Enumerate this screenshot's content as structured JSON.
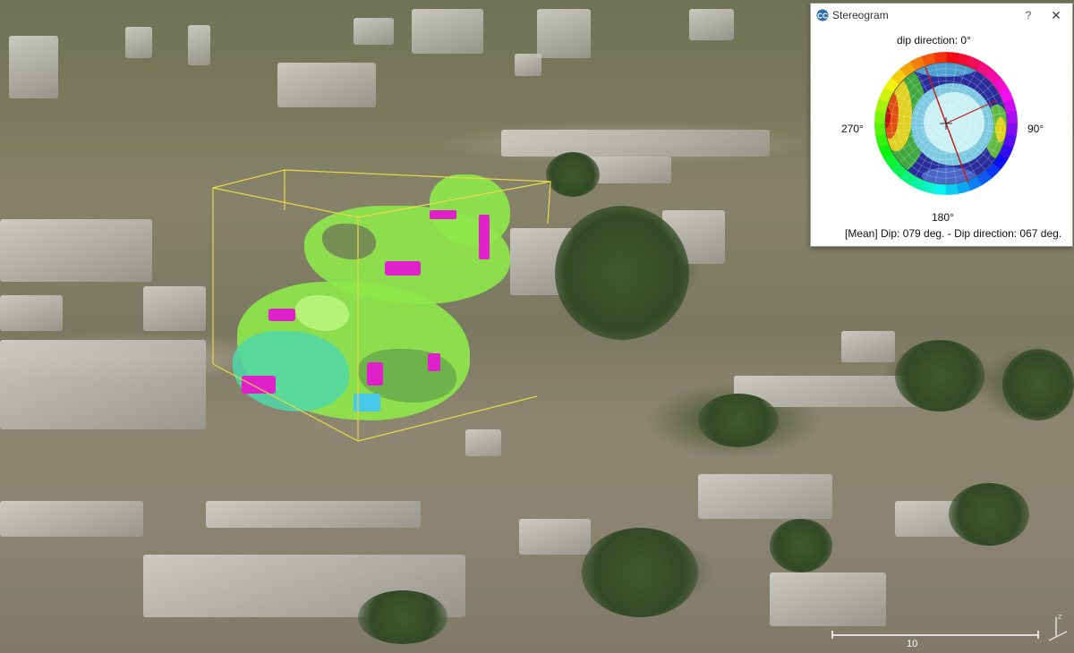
{
  "viewport": {
    "scale_label": "10"
  },
  "dialog": {
    "title": "Stereogram",
    "help_glyph": "?",
    "close_glyph": "✕",
    "top_label": "dip direction: 0°",
    "left_label": "270°",
    "right_label": "90°",
    "bottom_label": "180°",
    "mean_text": "[Mean] Dip: 079 deg. - Dip direction: 067 deg."
  },
  "colors": {
    "bbox": "#e8d84a",
    "facet_green": "#8ee84a",
    "facet_magenta": "#e020c8",
    "facet_teal": "#4fd8a8",
    "stereo_center": "#c8f0f4",
    "mean_line": "#c81e1e"
  }
}
